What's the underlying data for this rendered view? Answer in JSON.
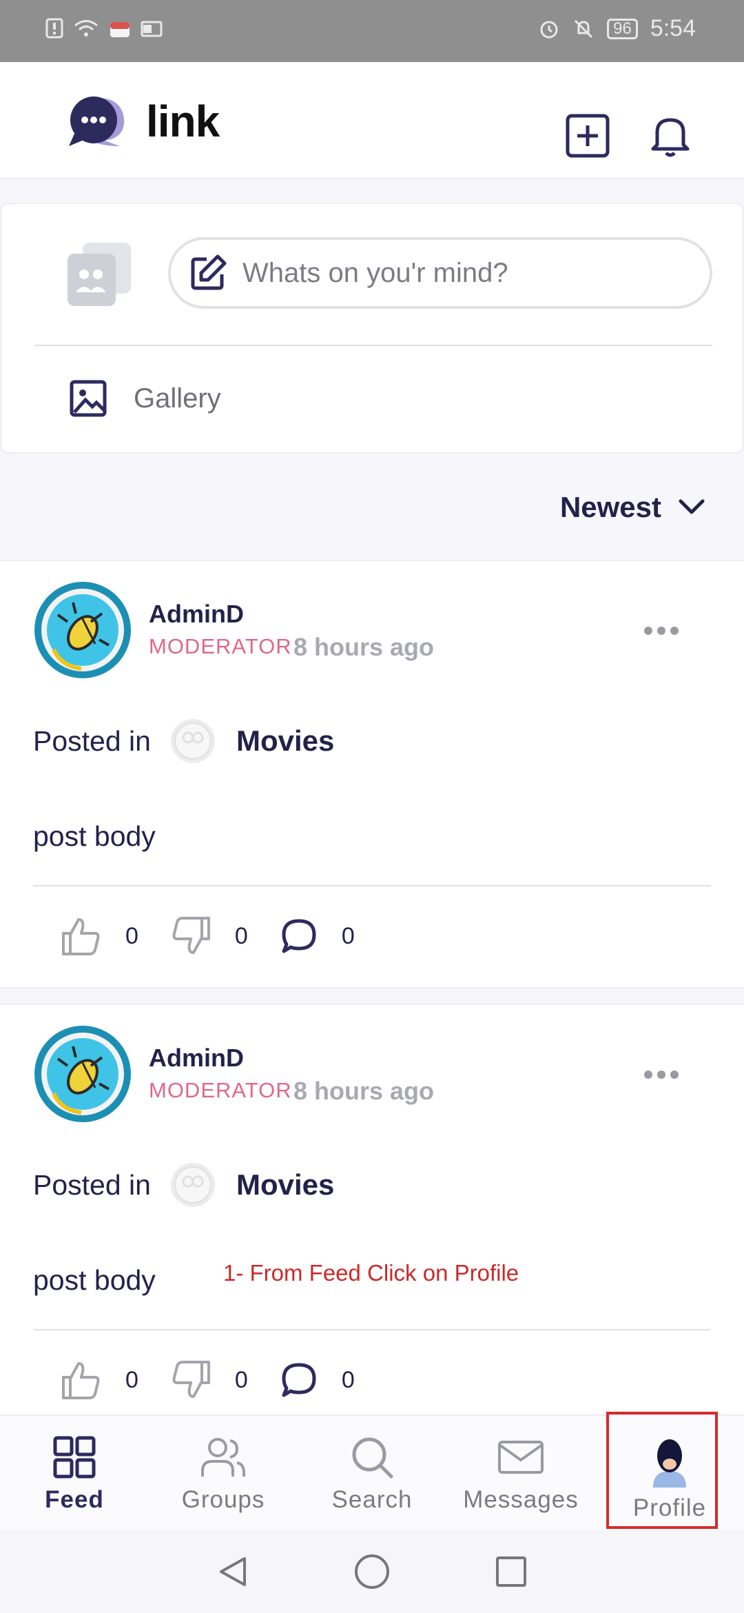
{
  "status_bar": {
    "time": "5:54",
    "battery": "96"
  },
  "header": {
    "logo_text": "link"
  },
  "composer": {
    "placeholder": "Whats on you'r mind?",
    "gallery_label": "Gallery"
  },
  "sort": {
    "label": "Newest"
  },
  "posts": [
    {
      "author": "AdminD",
      "role": "MODERATOR",
      "time": "8 hours ago",
      "posted_in_label": "Posted in",
      "group": "Movies",
      "body": "post body",
      "likes": "0",
      "dislikes": "0",
      "comments": "0"
    },
    {
      "author": "AdminD",
      "role": "MODERATOR",
      "time": "8 hours ago",
      "posted_in_label": "Posted in",
      "group": "Movies",
      "body": "post body",
      "likes": "0",
      "dislikes": "0",
      "comments": "0"
    }
  ],
  "annotation": {
    "text": "1- From Feed Click on Profile",
    "number": "1"
  },
  "bottom_nav": [
    {
      "label": "Feed",
      "icon": "grid-icon",
      "active": true
    },
    {
      "label": "Groups",
      "icon": "users-icon",
      "active": false
    },
    {
      "label": "Search",
      "icon": "search-icon",
      "active": false
    },
    {
      "label": "Messages",
      "icon": "mail-icon",
      "active": false
    },
    {
      "label": "Profile",
      "icon": "avatar",
      "active": false
    }
  ],
  "colors": {
    "brand": "#2d2a5e",
    "moderator": "#e0678a",
    "annotation": "#cc2929"
  }
}
